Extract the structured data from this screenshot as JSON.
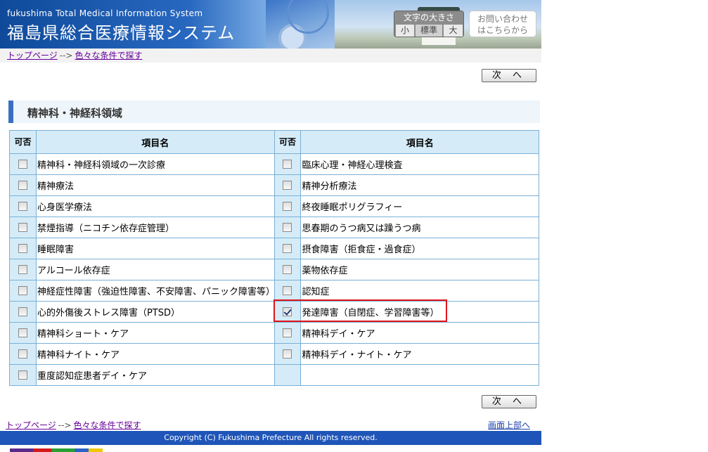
{
  "header": {
    "subtitle": "fukushima Total Medical Information System",
    "title": "福島県総合医療情報システム",
    "font_size": {
      "title": "文字の大きさ",
      "small": "小",
      "standard": "標準",
      "large": "大"
    },
    "inquiry": {
      "line1": "お問い合わせ",
      "line2": "はこちらから"
    }
  },
  "breadcrumb": {
    "home": "トップページ",
    "arrow": "-->",
    "current": "色々な条件で探す"
  },
  "next_button": "次 へ",
  "section_title": "精神科・神経科領域",
  "table": {
    "col_check": "可否",
    "col_name": "項目名",
    "rows": [
      {
        "left": {
          "name": "精神科・神経科領域の一次診療",
          "checked": false
        },
        "right": {
          "name": "臨床心理・神経心理検査",
          "checked": false
        }
      },
      {
        "left": {
          "name": "精神療法",
          "checked": false
        },
        "right": {
          "name": "精神分析療法",
          "checked": false
        }
      },
      {
        "left": {
          "name": "心身医学療法",
          "checked": false
        },
        "right": {
          "name": "終夜睡眠ポリグラフィー",
          "checked": false
        }
      },
      {
        "left": {
          "name": "禁煙指導（ニコチン依存症管理）",
          "checked": false
        },
        "right": {
          "name": "思春期のうつ病又は躁うつ病",
          "checked": false
        }
      },
      {
        "left": {
          "name": "睡眠障害",
          "checked": false
        },
        "right": {
          "name": "摂食障害（拒食症・過食症）",
          "checked": false
        }
      },
      {
        "left": {
          "name": "アルコール依存症",
          "checked": false
        },
        "right": {
          "name": "薬物依存症",
          "checked": false
        }
      },
      {
        "left": {
          "name": "神経症性障害（強迫性障害、不安障害、パニック障害等）",
          "checked": false
        },
        "right": {
          "name": "認知症",
          "checked": false
        }
      },
      {
        "left": {
          "name": "心的外傷後ストレス障害（PTSD）",
          "checked": false
        },
        "right": {
          "name": "発達障害（自閉症、学習障害等）",
          "checked": true
        }
      },
      {
        "left": {
          "name": "精神科ショート・ケア",
          "checked": false
        },
        "right": {
          "name": "精神科デイ・ケア",
          "checked": false
        }
      },
      {
        "left": {
          "name": "精神科ナイト・ケア",
          "checked": false
        },
        "right": {
          "name": "精神科デイ・ナイト・ケア",
          "checked": false
        }
      },
      {
        "left": {
          "name": "重度認知症患者デイ・ケア",
          "checked": false
        },
        "right": null
      }
    ]
  },
  "page_top_link": "画面上部へ",
  "footer": {
    "copyright": "Copyright (C) Fukushima Prefecture All rights reserved."
  },
  "colors": {
    "header_blue": "#1f55b8",
    "table_header": "#d5ecf8",
    "table_border": "#7ab0d6",
    "highlight": "#e0141a",
    "link_visited": "#660099"
  }
}
